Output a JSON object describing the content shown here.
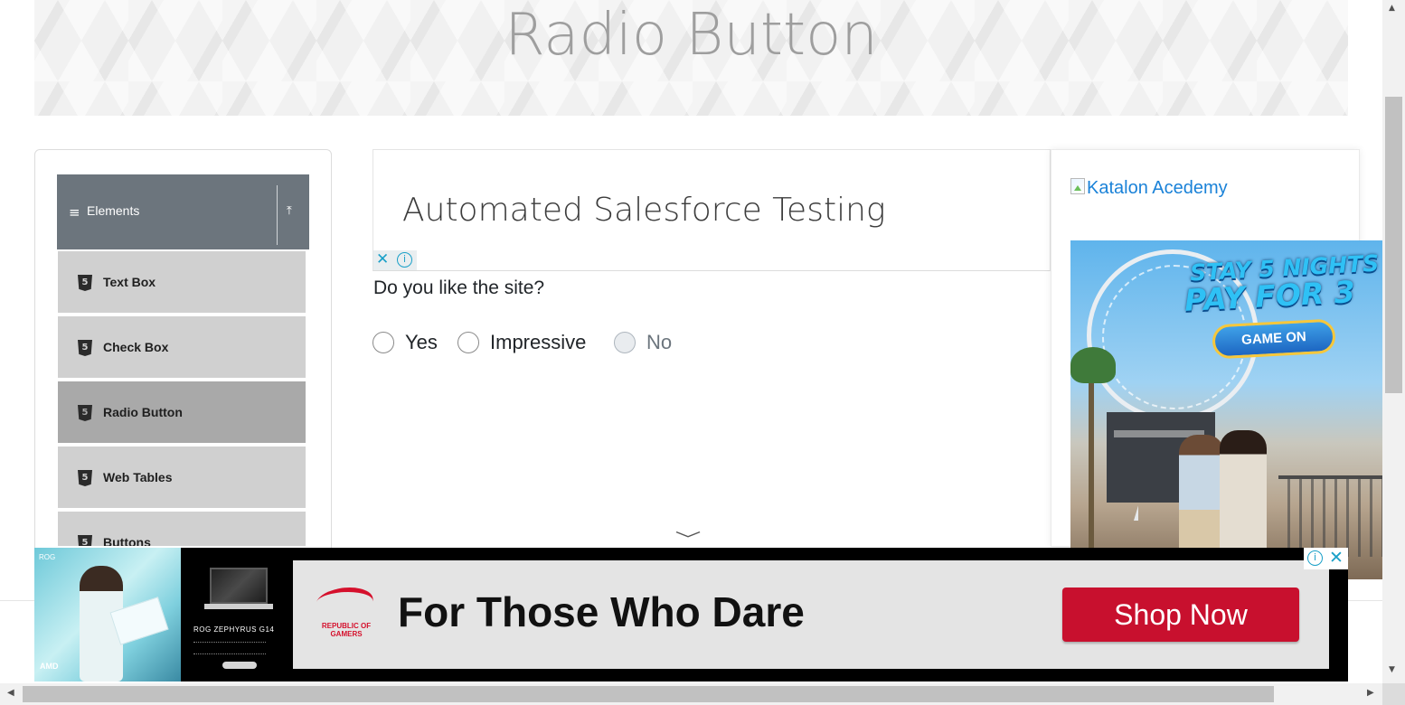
{
  "page": {
    "title": "Radio Button"
  },
  "sidebar": {
    "group": {
      "label": "Elements",
      "menu_icon": "≡",
      "collapse_icon": "⤒"
    },
    "items": [
      {
        "label": "Text Box",
        "icon": "html5-icon"
      },
      {
        "label": "Check Box",
        "icon": "html5-icon"
      },
      {
        "label": "Radio Button",
        "icon": "html5-icon",
        "active": true
      },
      {
        "label": "Web Tables",
        "icon": "html5-icon"
      },
      {
        "label": "Buttons",
        "icon": "html5-icon"
      }
    ]
  },
  "ad_top": {
    "title": "Automated Salesforce Testing",
    "close_icon": "✕",
    "info_icon": "i"
  },
  "main": {
    "question": "Do you like the site?",
    "options": [
      {
        "label": "Yes",
        "disabled": false
      },
      {
        "label": "Impressive",
        "disabled": false
      },
      {
        "label": "No",
        "disabled": true
      }
    ],
    "chevron": "﹀"
  },
  "right_ad": {
    "link_text": "Katalon Acedemy",
    "promo_line1": "STAY 5 NIGHTS",
    "promo_line2": "PAY FOR 3",
    "cta": "GAME ON"
  },
  "bottom_ad": {
    "tagline": "For Those Who Dare",
    "cta": "Shop Now",
    "model": "ROG ZEPHYRUS G14",
    "brand_line1": "REPUBLIC OF",
    "brand_line2": "GAMERS",
    "amd": "AMD",
    "info_icon": "i",
    "close_icon": "✕",
    "brand_color": "#c8102e"
  },
  "scrollbars": {
    "up": "▲",
    "down": "▼",
    "left": "◀",
    "right": "▶"
  }
}
